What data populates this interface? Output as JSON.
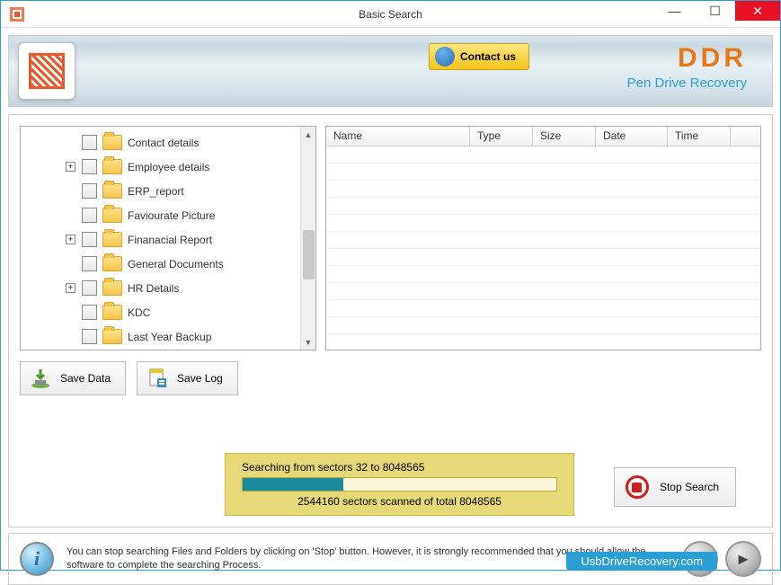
{
  "window": {
    "title": "Basic Search"
  },
  "header": {
    "contact_label": "Contact us",
    "brand": "DDR",
    "brand_sub": "Pen Drive Recovery"
  },
  "tree": {
    "items": [
      {
        "label": "Contact details",
        "expandable": false
      },
      {
        "label": "Employee details",
        "expandable": true
      },
      {
        "label": "ERP_report",
        "expandable": false
      },
      {
        "label": "Faviourate Picture",
        "expandable": false
      },
      {
        "label": "Finanacial Report",
        "expandable": true
      },
      {
        "label": "General Documents",
        "expandable": false
      },
      {
        "label": "HR Details",
        "expandable": true
      },
      {
        "label": "KDC",
        "expandable": false
      },
      {
        "label": "Last Year Backup",
        "expandable": false
      }
    ]
  },
  "list": {
    "columns": [
      "Name",
      "Type",
      "Size",
      "Date",
      "Time"
    ]
  },
  "buttons": {
    "save_data": "Save Data",
    "save_log": "Save Log",
    "stop_search": "Stop Search"
  },
  "progress": {
    "line1": "Searching from sectors  32 to 8048565",
    "line2": "2544160  sectors scanned of total 8048565",
    "percent": 32
  },
  "info": {
    "text": "You can stop searching Files and Folders by clicking on 'Stop' button. However, it is strongly recommended that you should allow the software to complete the searching Process."
  },
  "footer": {
    "link": "UsbDriveRecovery.com"
  }
}
